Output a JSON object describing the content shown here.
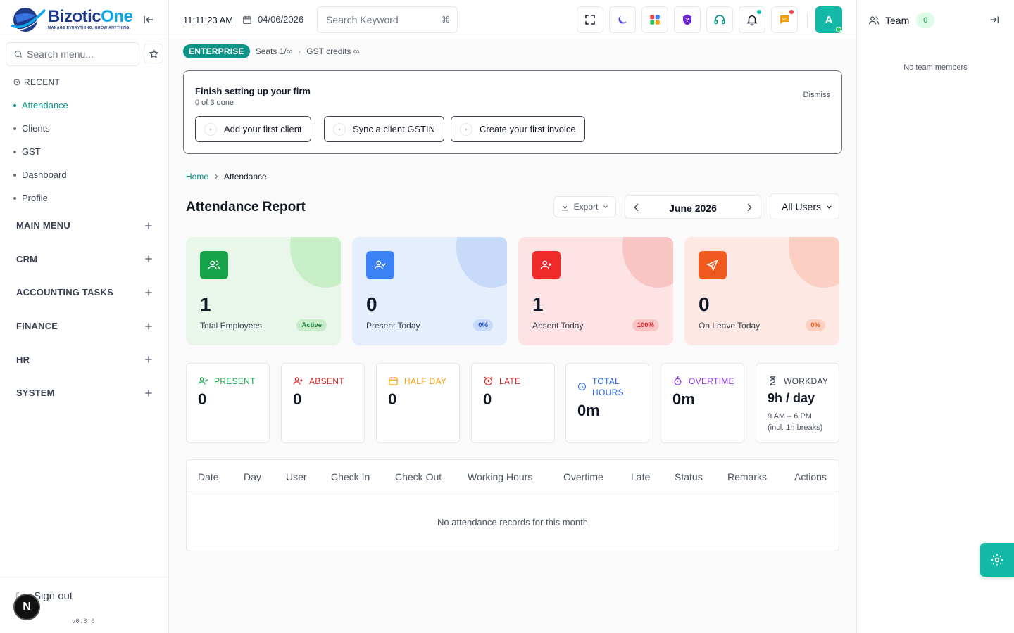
{
  "brand": {
    "name_part1": "Bizotic",
    "name_part2": "One",
    "tagline": "MANAGE EVERYTHING, GROW ANYTHING."
  },
  "sidebar": {
    "search_placeholder": "Search menu...",
    "recent_title": "RECENT",
    "recent_items": [
      {
        "label": "Attendance",
        "active": true
      },
      {
        "label": "Clients",
        "active": false
      },
      {
        "label": "GST",
        "active": false
      },
      {
        "label": "Dashboard",
        "active": false
      },
      {
        "label": "Profile",
        "active": false
      }
    ],
    "sections": [
      "MAIN MENU",
      "CRM",
      "ACCOUNTING TASKS",
      "FINANCE",
      "HR",
      "SYSTEM"
    ],
    "signout_label": "Sign out",
    "n_badge": "N",
    "version": "v0.3.0"
  },
  "topbar": {
    "time": "11:11:23 AM",
    "date": "04/06/2026",
    "search_placeholder": "Search Keyword",
    "search_shortcut": "⌘",
    "avatar_letter": "A",
    "icons": [
      "fullscreen-icon",
      "moon-icon",
      "apps-grid-icon",
      "help-shield-icon",
      "headset-icon",
      "bell-icon",
      "chat-icon"
    ]
  },
  "plan": {
    "badge": "ENTERPRISE",
    "seats": "Seats 1/∞",
    "dot": "·",
    "gst": "GST credits ∞"
  },
  "setup": {
    "title": "Finish setting up your firm",
    "progress": "0 of 3 done",
    "dismiss": "Dismiss",
    "steps": [
      "Add your first client",
      "Sync a client GSTIN",
      "Create your first invoice"
    ]
  },
  "breadcrumb": {
    "home": "Home",
    "current": "Attendance"
  },
  "page": {
    "title": "Attendance Report",
    "export_label": "Export",
    "month": "June 2026",
    "user_filter": "All Users"
  },
  "stats": [
    {
      "value": "1",
      "label": "Total Employees",
      "pill": "Active"
    },
    {
      "value": "0",
      "label": "Present Today",
      "pill": "0%"
    },
    {
      "value": "1",
      "label": "Absent Today",
      "pill": "100%"
    },
    {
      "value": "0",
      "label": "On Leave Today",
      "pill": "0%"
    }
  ],
  "metrics": [
    {
      "title": "PRESENT",
      "value": "0"
    },
    {
      "title": "ABSENT",
      "value": "0"
    },
    {
      "title": "HALF DAY",
      "value": "0"
    },
    {
      "title": "LATE",
      "value": "0"
    },
    {
      "title_line1": "TOTAL",
      "title_line2": "HOURS",
      "value": "0m"
    },
    {
      "title": "OVERTIME",
      "value": "0m"
    },
    {
      "title": "WORKDAY",
      "value": "9h / day",
      "note_line1": "9 AM – 6 PM",
      "note_line2": "(incl. 1h breaks)"
    }
  ],
  "table": {
    "columns": [
      "Date",
      "Day",
      "User",
      "Check In",
      "Check Out",
      "Working Hours",
      "Overtime",
      "Late",
      "Status",
      "Remarks",
      "Actions"
    ],
    "empty": "No attendance records for this month"
  },
  "team_panel": {
    "title": "Team",
    "count": "0",
    "empty": "No team members"
  },
  "colors": {
    "accent": "#0d9488",
    "teal_button": "#14b8a6",
    "green": "#22c55e",
    "blue": "#3b82f6",
    "red": "#ef4444",
    "orange": "#f97316"
  }
}
